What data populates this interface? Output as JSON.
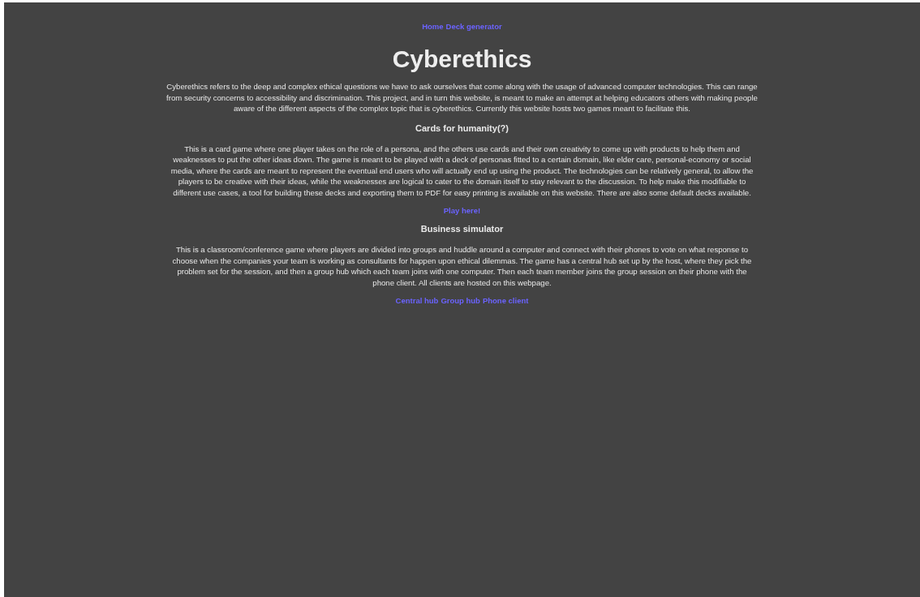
{
  "nav": [
    {
      "label": "Home"
    },
    {
      "label": "Deck generator"
    }
  ],
  "title": "Cyberethics",
  "intro": "Cyberethics refers to the deep and complex ethical questions we have to ask ourselves that come along with the usage of advanced computer technologies. This can range from security concerns to accessibility and discrimination. This project, and in turn this website, is meant to make an attempt at helping educators others with making people aware of the different aspects of the complex topic that is cyberethics. Currently this website hosts two games meant to facilitate this.",
  "sections": [
    {
      "heading": "Cards for humanity(?)",
      "text": "This is a card game where one player takes on the role of a persona, and the others use cards and their own creativity to come up with products to help them and weaknesses to put the other ideas down. The game is meant to be played with a deck of personas fitted to a certain domain, like elder care, personal-economy or social media, where the cards are meant to represent the eventual end users who will actually end up using the product. The technologies can be relatively general, to allow the players to be creative with their ideas, while the weaknesses are logical to cater to the domain itself to stay relevant to the discussion. To help make this modifiable to different use cases, a tool for building these decks and exporting them to PDF for easy printing is available on this website. There are also some default decks available.",
      "links": [
        {
          "label": "Play here!"
        }
      ]
    },
    {
      "heading": "Business simulator",
      "text": "This is a classroom/conference game where players are divided into groups and huddle around a computer and connect with their phones to vote on what response to choose when the companies your team is working as consultants for happen upon ethical dilemmas. The game has a central hub set up by the host, where they pick the problem set for the session, and then a group hub which each team joins with one computer. Then each team member joins the group session on their phone with the phone client. All clients are hosted on this webpage.",
      "links": [
        {
          "label": "Central hub"
        },
        {
          "label": "Group hub"
        },
        {
          "label": "Phone client"
        }
      ]
    }
  ]
}
